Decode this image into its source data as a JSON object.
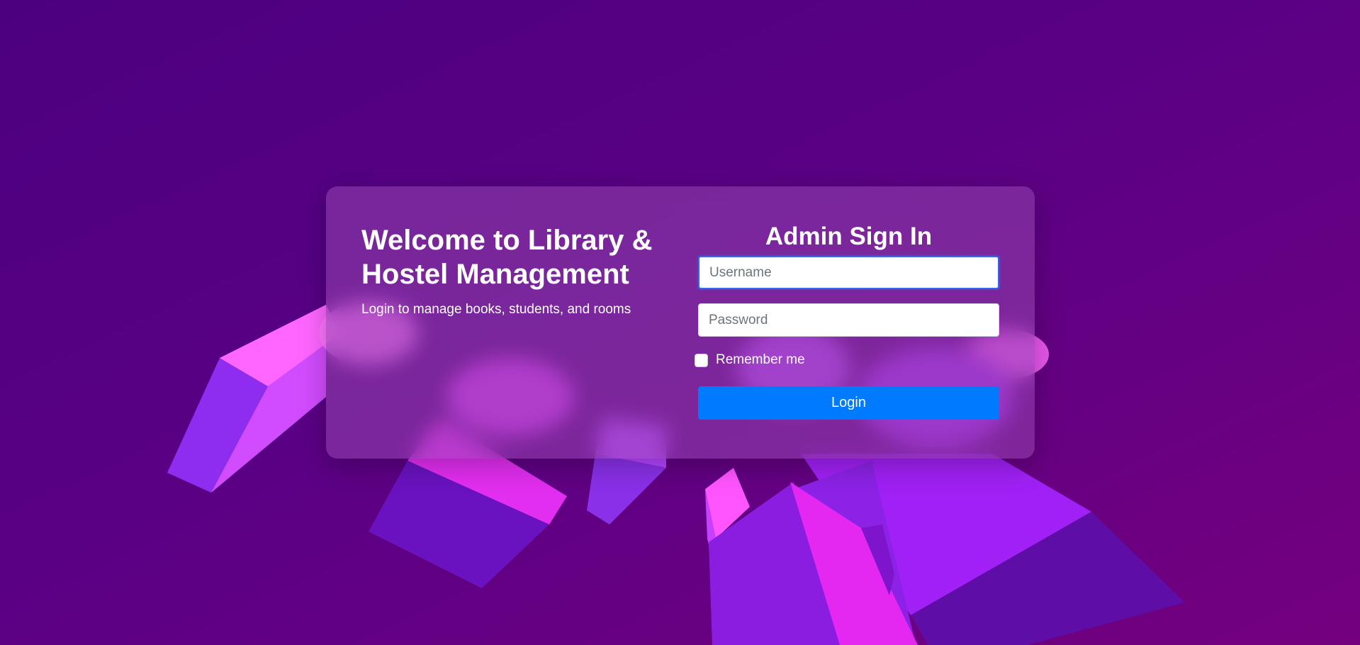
{
  "colors": {
    "background_start": "#4c0080",
    "background_end": "#74007f",
    "card_overlay": "#9646af",
    "accent_button": "#007bff",
    "focus_border": "#3b67e0",
    "cube_magenta": "#ff55ff",
    "cube_violet": "#9b30ff"
  },
  "welcome": {
    "title": "Welcome to Library & Hostel Management",
    "subtitle": "Login to manage books, students, and rooms"
  },
  "signin": {
    "title": "Admin Sign In",
    "username_placeholder": "Username",
    "username_value": "",
    "password_placeholder": "Password",
    "password_value": "",
    "remember_label": "Remember me",
    "remember_checked": false,
    "login_label": "Login"
  }
}
